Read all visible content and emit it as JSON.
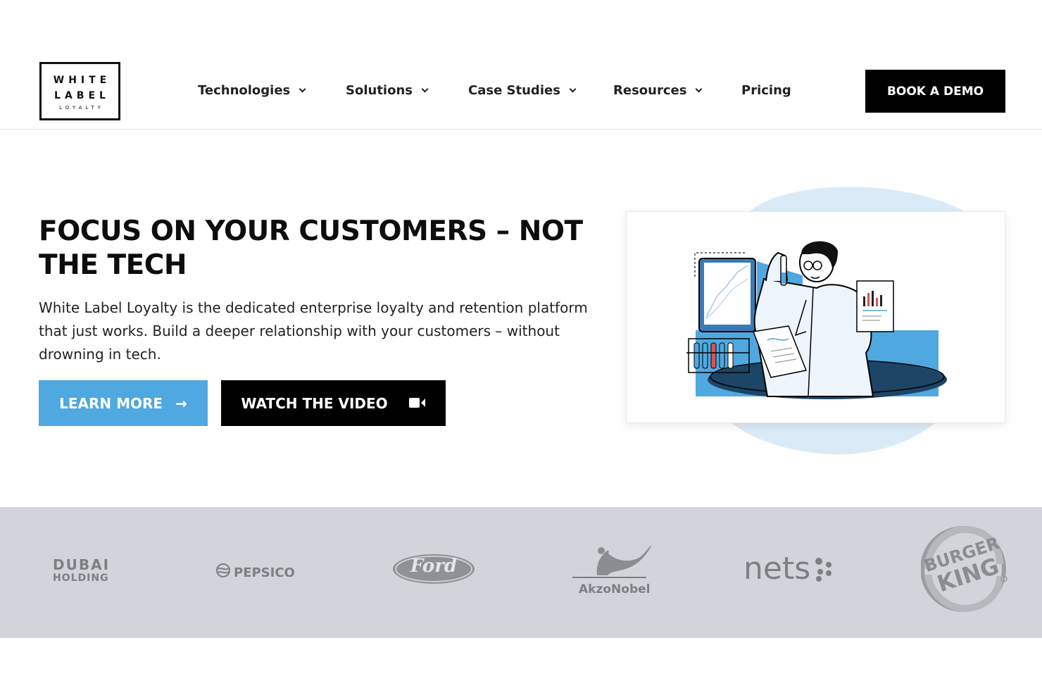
{
  "header": {
    "logo": {
      "line1": "WHITE",
      "line2": "LABEL",
      "line3": "LOYALTY"
    },
    "nav": [
      {
        "label": "Technologies",
        "has_dropdown": true
      },
      {
        "label": "Solutions",
        "has_dropdown": true
      },
      {
        "label": "Case Studies",
        "has_dropdown": true
      },
      {
        "label": "Resources",
        "has_dropdown": true
      },
      {
        "label": "Pricing",
        "has_dropdown": false
      }
    ],
    "cta": "BOOK A DEMO"
  },
  "hero": {
    "title": "FOCUS ON YOUR CUSTOMERS – NOT THE TECH",
    "text": "White Label Loyalty is the dedicated enterprise loyalty and retention platform that just works. Build a deeper relationship with your customers – without drowning in tech.",
    "learn_more": "LEARN MORE",
    "watch_video": "WATCH THE VIDEO"
  },
  "clients": {
    "dubai": {
      "line1": "DUBAI",
      "line2": "HOLDING"
    },
    "pepsico": "PEPSICO",
    "ford": "Ford",
    "akzonobel": "AkzoNobel",
    "nets": "nets",
    "burger_king": {
      "line1": "BURGER",
      "line2": "KING"
    }
  },
  "colors": {
    "accent": "#4fa8e0",
    "dark": "#000000",
    "band": "#d1d4da",
    "logo_gray": "#7c7f84",
    "blob": "#dbeaf7"
  }
}
